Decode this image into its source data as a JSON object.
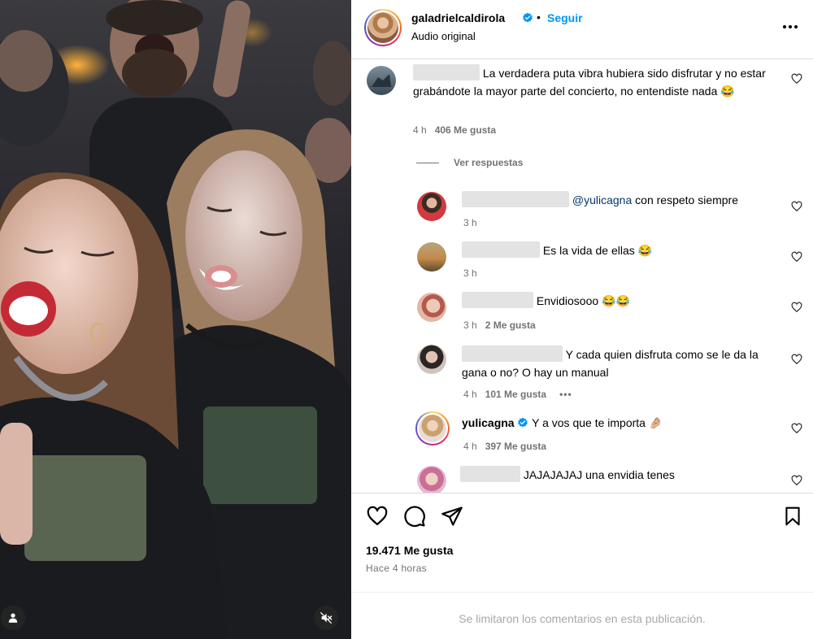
{
  "header": {
    "username": "galadrielcaldirola",
    "separator": "•",
    "follow_label": "Seguir",
    "audio_label": "Audio original"
  },
  "comments": [
    {
      "text": "La verdadera puta vibra hubiera sido disfrutar y no estar grabándote la mayor parte del concierto, no entendiste nada 😂",
      "time": "4 h",
      "likes": "406 Me gusta"
    }
  ],
  "view_replies_label": "Ver respuestas",
  "replies": [
    {
      "mention": "@yulicagna",
      "text": " con respeto siempre",
      "time": "3 h",
      "likes": ""
    },
    {
      "text": "Es la vida de ellas 😂",
      "time": "3 h",
      "likes": ""
    },
    {
      "text": "Envidiosooo 😂😂",
      "time": "3 h",
      "likes": "2 Me gusta"
    },
    {
      "text": "Y cada quien disfruta como se le da la gana o no? O hay un manual",
      "time": "4 h",
      "likes": "101 Me gusta",
      "more": "•••"
    },
    {
      "username": "yulicagna",
      "text": "Y a vos que te importa 🤌🏼",
      "time": "4 h",
      "likes": "397 Me gusta"
    },
    {
      "text": "JAJAJAJAJ una envidia tenes",
      "time": "",
      "likes": ""
    }
  ],
  "actions": {
    "likes_count": "19.471 Me gusta",
    "time_ago": "Hace 4 horas"
  },
  "footer": {
    "comments_limited": "Se limitaron los comentarios en esta publicación."
  },
  "colors": {
    "accent": "#0095f6",
    "secondary_text": "#737373",
    "border": "#dbdbdb",
    "mention": "#00376b"
  },
  "icons": [
    "user-tag-icon",
    "mute-icon",
    "verified-icon",
    "more-icon",
    "heart-icon",
    "comment-icon",
    "share-icon",
    "save-icon"
  ]
}
